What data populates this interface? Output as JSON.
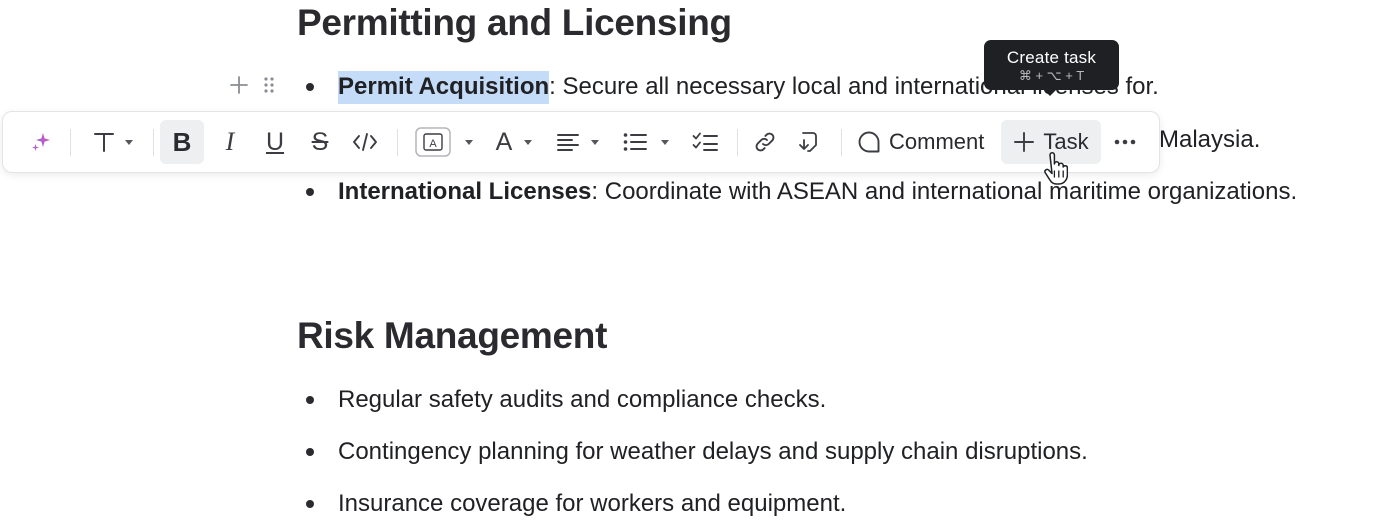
{
  "sections": {
    "permitting": {
      "heading": "Permitting and Licensing",
      "items": [
        {
          "bold": "Permit Acquisition",
          "text": ": Secure all necessary local and international licenses for."
        },
        {
          "text_end": "Malaysia."
        },
        {
          "bold": "International Licenses",
          "text": ": Coordinate with ASEAN and international maritime organizations."
        }
      ]
    },
    "risk": {
      "heading": "Risk Management",
      "items": [
        "Regular safety audits and compliance checks.",
        "Contingency planning for weather delays and supply chain disruptions.",
        "Insurance coverage for workers and equipment."
      ]
    }
  },
  "toolbar": {
    "buttons": [
      {
        "name": "ai-assist",
        "icon": "sparkle-icon"
      },
      {
        "name": "text-style",
        "icon": "text-t-icon",
        "dropdown": true
      },
      {
        "name": "bold",
        "icon": "bold-icon",
        "active": true
      },
      {
        "name": "italic",
        "icon": "italic-icon"
      },
      {
        "name": "underline",
        "icon": "underline-icon"
      },
      {
        "name": "strikethrough",
        "icon": "strikethrough-icon"
      },
      {
        "name": "code",
        "icon": "code-icon"
      },
      {
        "name": "highlight",
        "icon": "text-box-icon",
        "dropdown": true
      },
      {
        "name": "text-color",
        "icon": "text-color-icon",
        "dropdown": true
      },
      {
        "name": "align",
        "icon": "align-left-icon",
        "dropdown": true
      },
      {
        "name": "bulleted-list",
        "icon": "bullet-list-icon",
        "dropdown": true
      },
      {
        "name": "checklist",
        "icon": "checklist-icon"
      },
      {
        "name": "link",
        "icon": "link-icon"
      },
      {
        "name": "turn-into",
        "icon": "turn-into-icon"
      },
      {
        "name": "more",
        "icon": "more-icon"
      }
    ],
    "comment_label": "Comment",
    "task_label": "Task"
  },
  "tooltip": {
    "title": "Create task",
    "shortcut": "⌘ + ⌥ + T"
  },
  "colors": {
    "selection_highlight": "#c5dcf8",
    "tooltip_bg": "#1f2023",
    "ai_gradient_start": "#a855f7",
    "ai_gradient_end": "#ec4899"
  }
}
